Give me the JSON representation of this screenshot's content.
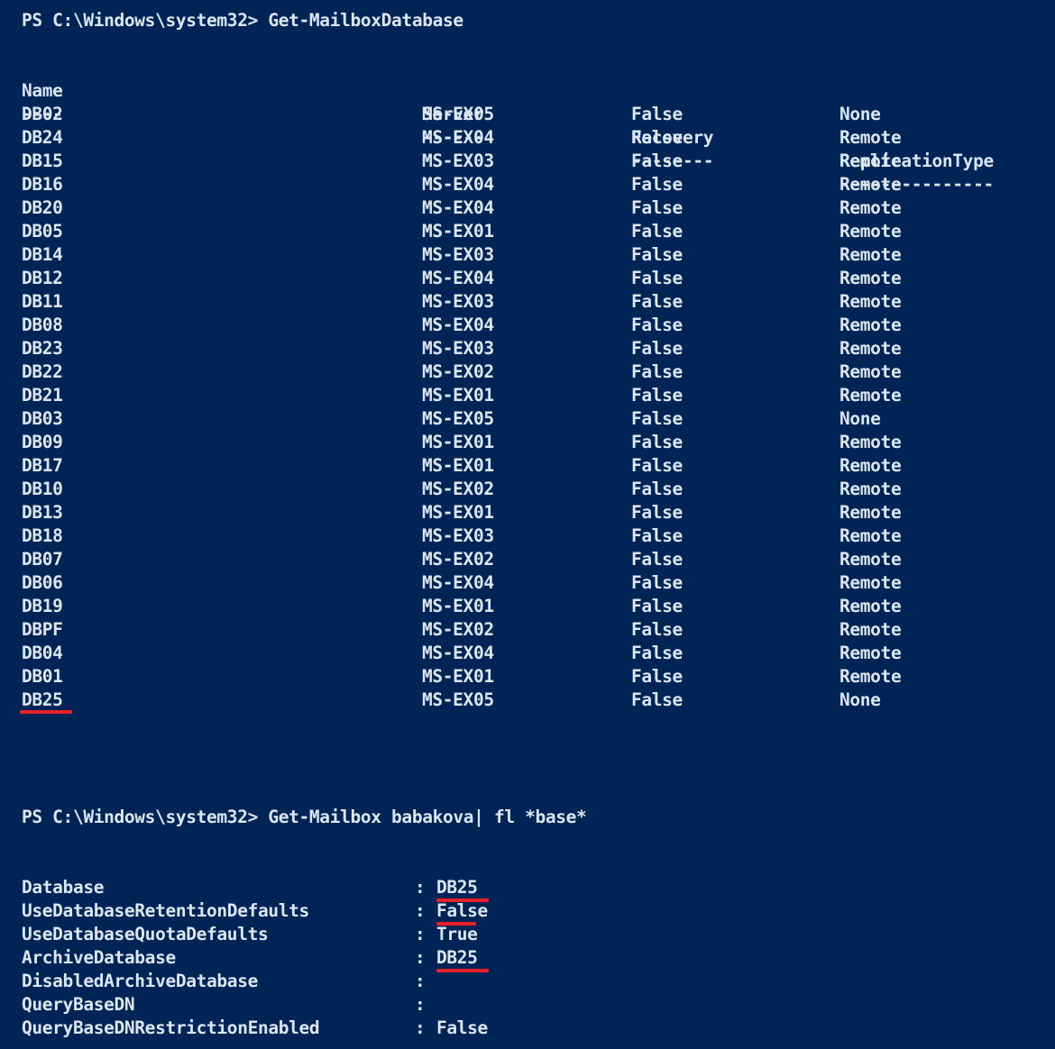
{
  "console": {
    "background_color": "#012456",
    "text_color": "#dce6f0",
    "highlight_color": "#e8202a",
    "prompt_path": "PS C:\\Windows\\system32>"
  },
  "command_1": {
    "prompt": "PS C:\\Windows\\system32>",
    "command": "Get-MailboxDatabase",
    "full_line": "PS C:\\Windows\\system32> Get-MailboxDatabase"
  },
  "table": {
    "headers": [
      "Name",
      "Server",
      "Recovery",
      "ReplicationType"
    ],
    "separators": [
      "----",
      "------",
      "--------",
      "---------------"
    ],
    "rows": [
      {
        "name": "DB02",
        "server": "MS-EX05",
        "recovery": "False",
        "replication": "None"
      },
      {
        "name": "DB24",
        "server": "MS-EX04",
        "recovery": "False",
        "replication": "Remote"
      },
      {
        "name": "DB15",
        "server": "MS-EX03",
        "recovery": "False",
        "replication": "Remote"
      },
      {
        "name": "DB16",
        "server": "MS-EX04",
        "recovery": "False",
        "replication": "Remote"
      },
      {
        "name": "DB20",
        "server": "MS-EX04",
        "recovery": "False",
        "replication": "Remote"
      },
      {
        "name": "DB05",
        "server": "MS-EX01",
        "recovery": "False",
        "replication": "Remote"
      },
      {
        "name": "DB14",
        "server": "MS-EX03",
        "recovery": "False",
        "replication": "Remote"
      },
      {
        "name": "DB12",
        "server": "MS-EX04",
        "recovery": "False",
        "replication": "Remote"
      },
      {
        "name": "DB11",
        "server": "MS-EX03",
        "recovery": "False",
        "replication": "Remote"
      },
      {
        "name": "DB08",
        "server": "MS-EX04",
        "recovery": "False",
        "replication": "Remote"
      },
      {
        "name": "DB23",
        "server": "MS-EX03",
        "recovery": "False",
        "replication": "Remote"
      },
      {
        "name": "DB22",
        "server": "MS-EX02",
        "recovery": "False",
        "replication": "Remote"
      },
      {
        "name": "DB21",
        "server": "MS-EX01",
        "recovery": "False",
        "replication": "Remote"
      },
      {
        "name": "DB03",
        "server": "MS-EX05",
        "recovery": "False",
        "replication": "None"
      },
      {
        "name": "DB09",
        "server": "MS-EX01",
        "recovery": "False",
        "replication": "Remote"
      },
      {
        "name": "DB17",
        "server": "MS-EX01",
        "recovery": "False",
        "replication": "Remote"
      },
      {
        "name": "DB10",
        "server": "MS-EX02",
        "recovery": "False",
        "replication": "Remote"
      },
      {
        "name": "DB13",
        "server": "MS-EX01",
        "recovery": "False",
        "replication": "Remote"
      },
      {
        "name": "DB18",
        "server": "MS-EX03",
        "recovery": "False",
        "replication": "Remote"
      },
      {
        "name": "DB07",
        "server": "MS-EX02",
        "recovery": "False",
        "replication": "Remote"
      },
      {
        "name": "DB06",
        "server": "MS-EX04",
        "recovery": "False",
        "replication": "Remote"
      },
      {
        "name": "DB19",
        "server": "MS-EX01",
        "recovery": "False",
        "replication": "Remote"
      },
      {
        "name": "DBPF",
        "server": "MS-EX02",
        "recovery": "False",
        "replication": "Remote"
      },
      {
        "name": "DB04",
        "server": "MS-EX04",
        "recovery": "False",
        "replication": "Remote"
      },
      {
        "name": "DB01",
        "server": "MS-EX01",
        "recovery": "False",
        "replication": "Remote"
      },
      {
        "name": "DB25",
        "server": "MS-EX05",
        "recovery": "False",
        "replication": "None"
      }
    ]
  },
  "command_2": {
    "prompt": "PS C:\\Windows\\system32>",
    "command": "Get-Mailbox babakova| fl *base*",
    "full_line": "PS C:\\Windows\\system32> Get-Mailbox babakova| fl *base*"
  },
  "properties": [
    {
      "key": "Database",
      "colon": ":",
      "value": "DB25"
    },
    {
      "key": "UseDatabaseRetentionDefaults",
      "colon": ":",
      "value": "False"
    },
    {
      "key": "UseDatabaseQuotaDefaults",
      "colon": ":",
      "value": "True"
    },
    {
      "key": "ArchiveDatabase",
      "colon": ":",
      "value": "DB25"
    },
    {
      "key": "DisabledArchiveDatabase",
      "colon": ":",
      "value": ""
    },
    {
      "key": "QueryBaseDN",
      "colon": ":",
      "value": ""
    },
    {
      "key": "QueryBaseDNRestrictionEnabled",
      "colon": ":",
      "value": "False"
    }
  ]
}
